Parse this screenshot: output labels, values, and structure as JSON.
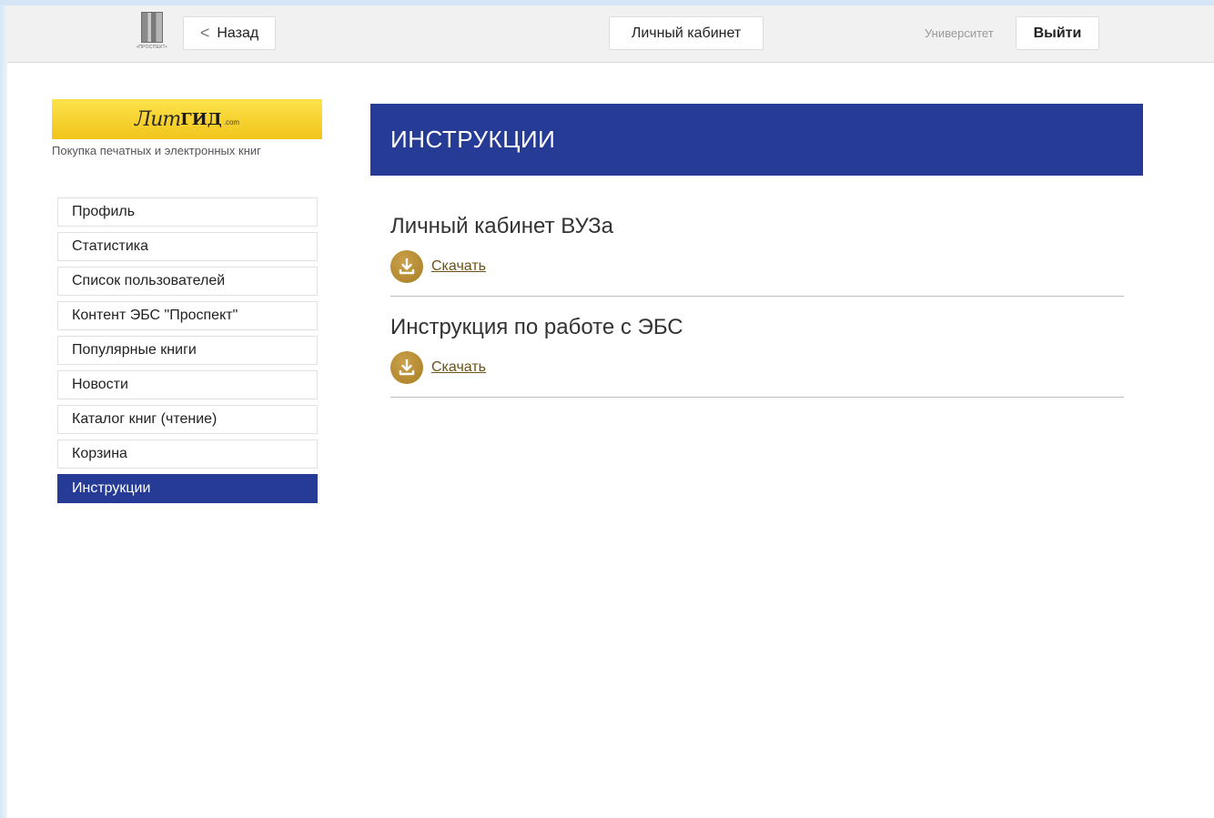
{
  "header": {
    "logo_caption": "•ПРОСПЕКТ•",
    "back_label": "Назад",
    "cabinet_label": "Личный кабинет",
    "university_label": "Университет",
    "logout_label": "Выйти"
  },
  "brand": {
    "logo_script": "Лит",
    "logo_bold": "ГИД",
    "logo_domain": ".com",
    "tagline": "Покупка печатных и электронных книг",
    "banner_color": "#f5cf22"
  },
  "sidebar": {
    "items": [
      {
        "label": "Профиль",
        "active": false
      },
      {
        "label": "Статистика",
        "active": false
      },
      {
        "label": "Список пользователей",
        "active": false
      },
      {
        "label": "Контент ЭБС \"Проспект\"",
        "active": false
      },
      {
        "label": "Популярные книги",
        "active": false
      },
      {
        "label": "Новости",
        "active": false
      },
      {
        "label": "Каталог книг (чтение)",
        "active": false
      },
      {
        "label": "Корзина",
        "active": false
      },
      {
        "label": "Инструкции",
        "active": true
      }
    ]
  },
  "main": {
    "page_title": "ИНСТРУКЦИИ",
    "documents": [
      {
        "title": "Личный кабинет ВУЗа",
        "download_label": "Скачать",
        "icon": "download-icon"
      },
      {
        "title": "Инструкция по работе с ЭБС",
        "download_label": "Скачать",
        "icon": "download-icon"
      }
    ]
  },
  "colors": {
    "accent": "#263b96",
    "download_icon": "#b68b2f",
    "link": "#6b5316"
  }
}
